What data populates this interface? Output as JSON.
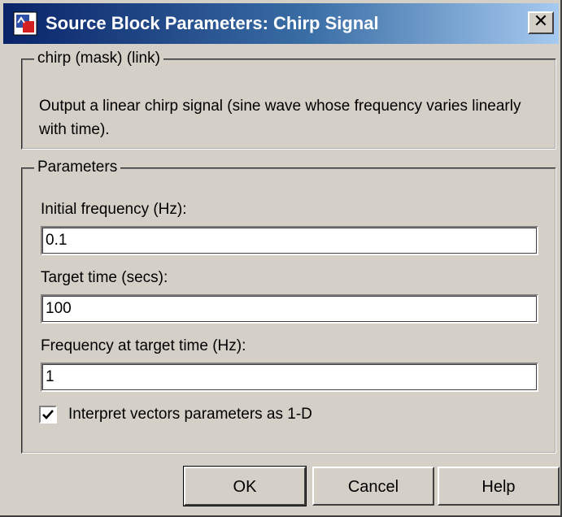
{
  "window": {
    "title": "Source Block Parameters: Chirp Signal",
    "close_label": "✕"
  },
  "mask": {
    "legend": "chirp (mask) (link)",
    "description": "Output a linear chirp signal (sine wave  whose frequency varies linearly with time)."
  },
  "params": {
    "legend": "Parameters",
    "fields": [
      {
        "label": "Initial frequency (Hz):",
        "value": "0.1"
      },
      {
        "label": "Target time (secs):",
        "value": "100"
      },
      {
        "label": "Frequency at target time (Hz):",
        "value": "1"
      }
    ],
    "checkbox": {
      "label": "Interpret vectors parameters as 1-D",
      "checked": true
    }
  },
  "buttons": {
    "ok": "OK",
    "cancel": "Cancel",
    "help": "Help"
  },
  "colors": {
    "title_start": "#0a246a",
    "title_end": "#a6caf0",
    "face": "#d4d0c8"
  }
}
